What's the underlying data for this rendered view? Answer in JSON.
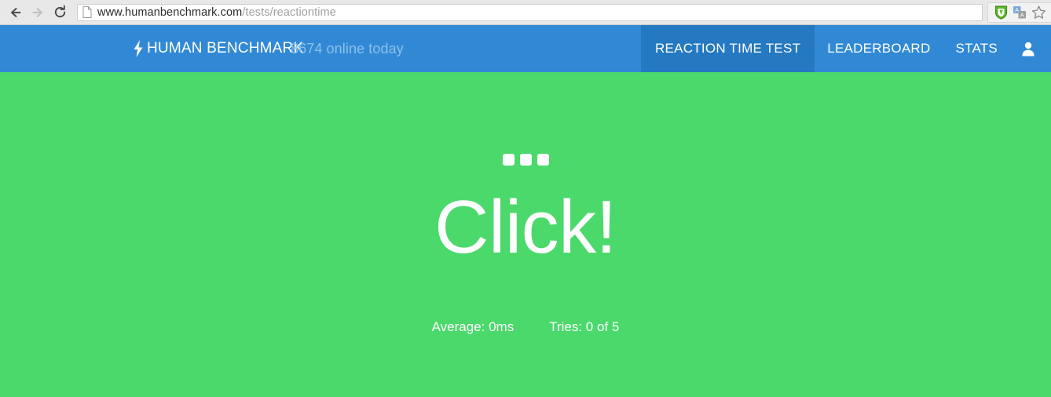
{
  "browser": {
    "back_label": "Back",
    "forward_label": "Forward",
    "reload_label": "Reload",
    "url_host": "www.humanbenchmark.com",
    "url_path": "/tests/reactiontime",
    "extensions": [
      {
        "name": "shield-icon",
        "label": "Ad Blocker"
      },
      {
        "name": "translate-icon",
        "label": "Translate"
      },
      {
        "name": "star-icon",
        "label": "Bookmark"
      }
    ]
  },
  "site": {
    "brand": "HUMAN BENCHMARK",
    "brand_icon": "bolt-icon",
    "online_today": "8674 online today",
    "nav": [
      {
        "label": "REACTION TIME TEST",
        "active": true
      },
      {
        "label": "LEADERBOARD",
        "active": false
      },
      {
        "label": "STATS",
        "active": false
      }
    ],
    "account_icon": "user-icon"
  },
  "test": {
    "prompt": "Click!",
    "indicator_dots": 3,
    "average_label": "Average: 0ms",
    "tries_label": "Tries: 0 of 5",
    "average_ms": 0,
    "tries_done": 0,
    "tries_total": 5
  },
  "colors": {
    "green": "#4BD96B",
    "nav_blue": "#3189D5",
    "nav_blue_active": "#2579C0",
    "muted_blue": "#8CC0E9",
    "white": "#FFFFFF"
  }
}
